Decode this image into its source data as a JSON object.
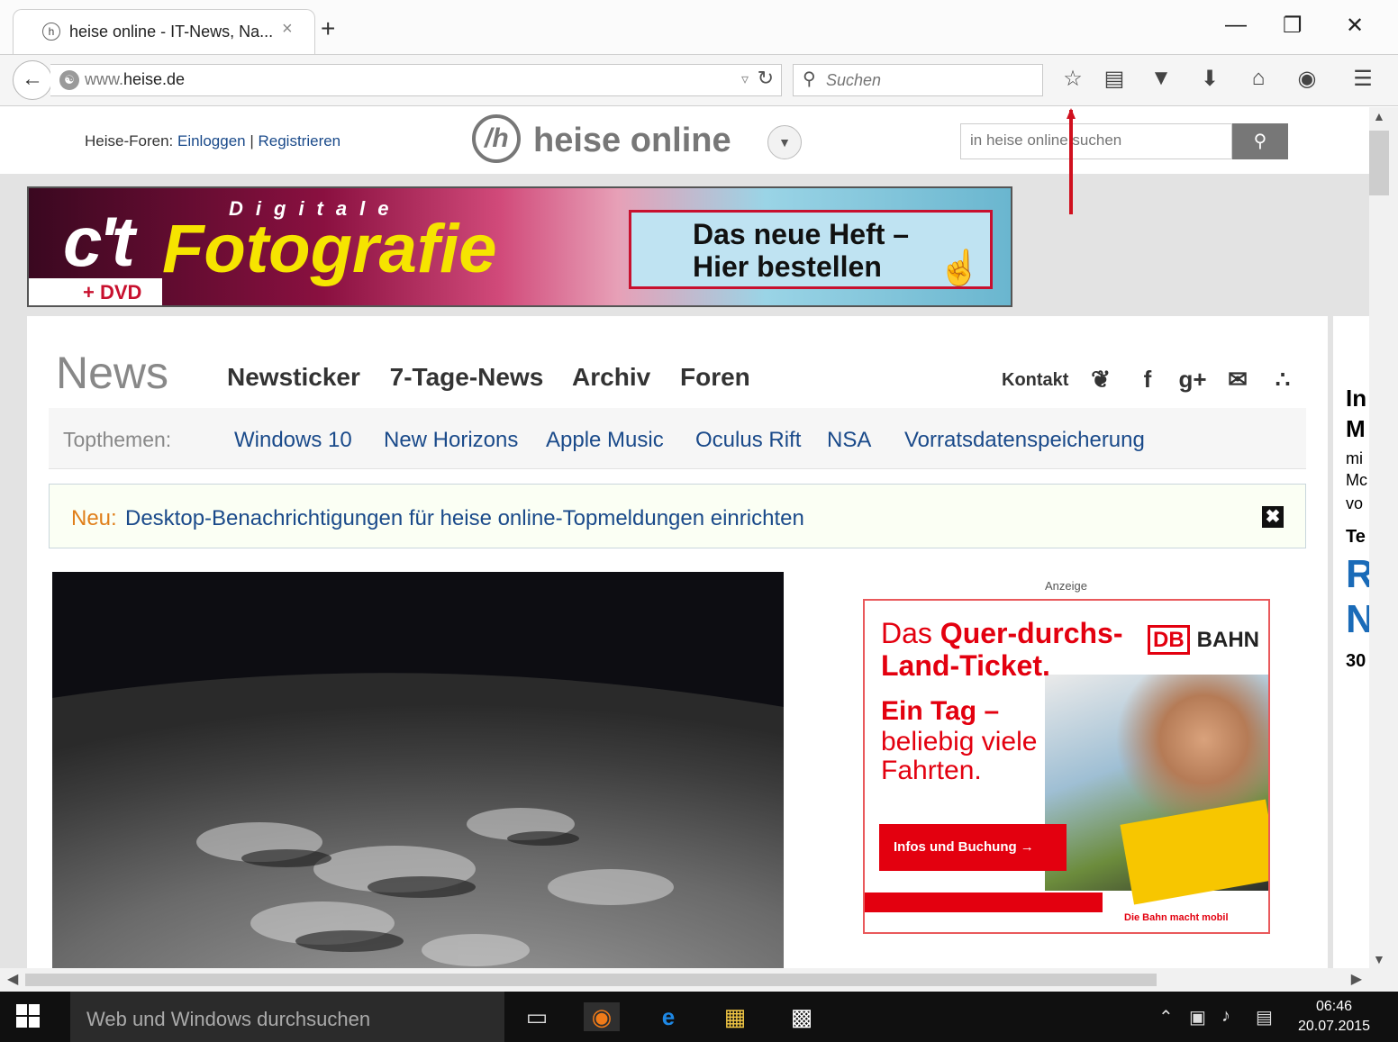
{
  "browser": {
    "tab_title": "heise online - IT-News, Na...",
    "tab_close": "×",
    "new_tab": "+",
    "win_min": "—",
    "win_max": "❐",
    "win_close": "✕",
    "url_prefix": "www.",
    "url_domain": "heise.de",
    "search_placeholder": "Suchen",
    "toolbar_icons": [
      "star-icon",
      "reading-list-icon",
      "pocket-icon",
      "download-icon",
      "home-icon",
      "chat-icon",
      "menu-icon"
    ]
  },
  "page": {
    "forum_prefix": "Heise-Foren: ",
    "login": "Einloggen",
    "sep": " | ",
    "register": "Registrieren",
    "logo_text": "heise online",
    "logo_mark": "/h",
    "site_search_placeholder": "in heise online suchen",
    "banner": {
      "ct": "c't",
      "digitale": "Digitale",
      "fotografie": "Fotografie",
      "dvd": "+ DVD",
      "cta_line1": "Das neue Heft –",
      "cta_line2": "Hier bestellen"
    },
    "news_title": "News",
    "nav": [
      "Newsticker",
      "7-Tage-News",
      "Archiv",
      "Foren"
    ],
    "kontakt": "Kontakt",
    "topthemen_label": "Topthemen:",
    "topthemen": [
      "Windows 10",
      "New Horizons",
      "Apple Music",
      "Oculus Rift",
      "NSA",
      "Vorratsdatenspeicherung"
    ],
    "notice_neu": "Neu:",
    "notice_msg": "Desktop-Benachrichtigungen für heise online-Topmeldungen einrichten",
    "notice_close": "✖",
    "anzeige": "Anzeige",
    "ad": {
      "das": "Das ",
      "quer": "Quer-durchs-",
      "land": "Land-Ticket.",
      "ein_tag": "Ein Tag –",
      "beliebig": "beliebig viele",
      "fahrten": "Fahrten.",
      "db": "DB",
      "bahn": "BAHN",
      "button": "Infos und Buchung →",
      "slogan": "Die Bahn macht mobil"
    },
    "right_peek": [
      "In",
      "M",
      "mi",
      "Mc",
      "vo",
      "Te",
      "R",
      "N",
      "30"
    ]
  },
  "taskbar": {
    "search": "Web und Windows durchsuchen",
    "time": "06:46",
    "date": "20.07.2015"
  }
}
